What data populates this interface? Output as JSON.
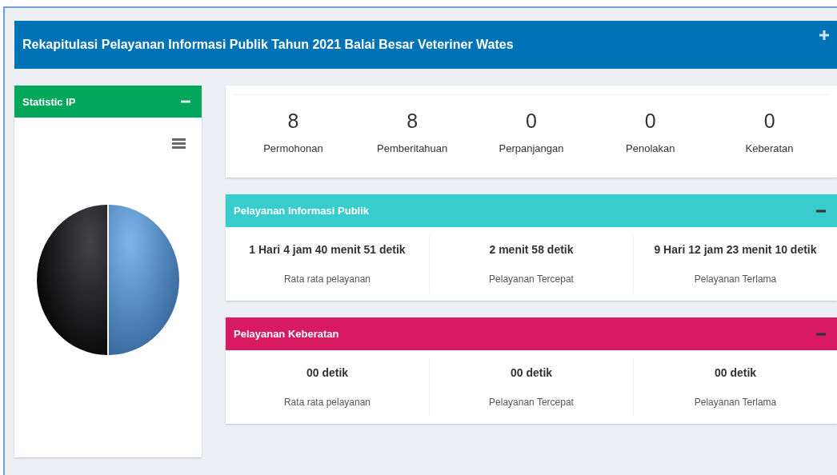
{
  "header": {
    "title": "Rekapitulasi Pelayanan Informasi Publik Tahun 2021 Balai Besar Veteriner Wates",
    "collapsed": true
  },
  "statistic": {
    "title": "Statistic IP",
    "collapsed": false
  },
  "counts": [
    {
      "value": "8",
      "label": "Permohonan"
    },
    {
      "value": "8",
      "label": "Pemberitahuan"
    },
    {
      "value": "0",
      "label": "Perpanjangan"
    },
    {
      "value": "0",
      "label": "Penolakan"
    },
    {
      "value": "0",
      "label": "Keberatan"
    }
  ],
  "panels": [
    {
      "title": "Pelayanan Informasi Publik",
      "color": "#39cccc",
      "collapsed": false,
      "items": [
        {
          "value": "1 Hari 4 jam 40 menit 51 detik",
          "label": "Rata rata pelayanan"
        },
        {
          "value": "2 menit 58 detik",
          "label": "Pelayanan Tercepat"
        },
        {
          "value": "9 Hari 12 jam 23 menit 10 detik",
          "label": "Pelayanan Terlama"
        }
      ]
    },
    {
      "title": "Pelayanan Keberatan",
      "color": "#d81b60",
      "collapsed": false,
      "items": [
        {
          "value": "00 detik",
          "label": "Rata rata pelayanan"
        },
        {
          "value": "00 detik",
          "label": "Pelayanan Tercepat"
        },
        {
          "value": "00 detik",
          "label": "Pelayanan Terlama"
        }
      ]
    }
  ]
}
